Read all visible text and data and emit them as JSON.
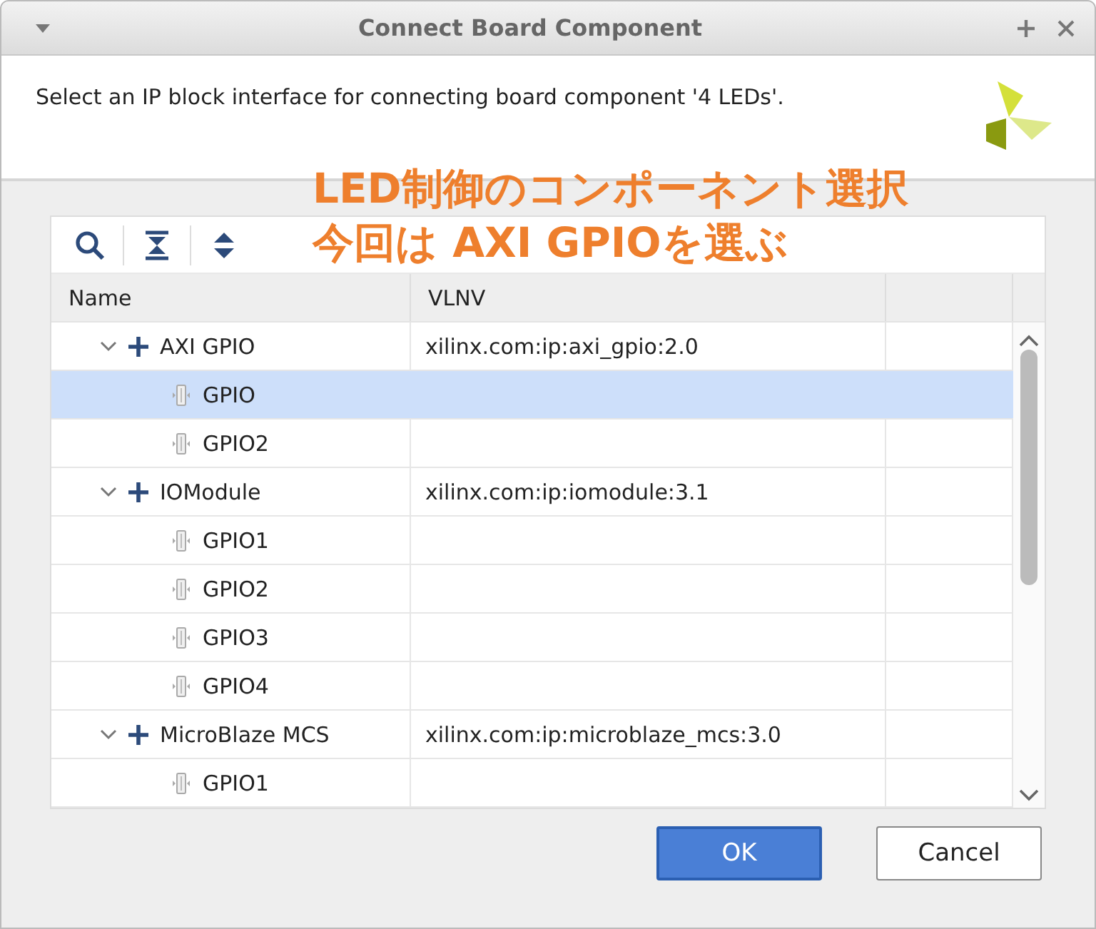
{
  "window": {
    "title": "Connect Board Component"
  },
  "message": "Select an IP block interface for connecting board component '4 LEDs'.",
  "annotation": [
    "LED制御のコンポーネント選択",
    "今回は AXI GPIOを選ぶ"
  ],
  "table": {
    "columns": [
      "Name",
      "VLNV"
    ],
    "rows": [
      {
        "name": "AXI GPIO",
        "vlnv": "xilinx.com:ip:axi_gpio:2.0",
        "expanded": true,
        "selected": false,
        "children": [
          {
            "name": "GPIO",
            "selected": true
          },
          {
            "name": "GPIO2",
            "selected": false
          }
        ]
      },
      {
        "name": "IOModule",
        "vlnv": "xilinx.com:ip:iomodule:3.1",
        "expanded": true,
        "selected": false,
        "children": [
          {
            "name": "GPIO1",
            "selected": false
          },
          {
            "name": "GPIO2",
            "selected": false
          },
          {
            "name": "GPIO3",
            "selected": false
          },
          {
            "name": "GPIO4",
            "selected": false
          }
        ]
      },
      {
        "name": "MicroBlaze MCS",
        "vlnv": "xilinx.com:ip:microblaze_mcs:3.0",
        "expanded": true,
        "selected": false,
        "children": [
          {
            "name": "GPIO1",
            "selected": false
          }
        ]
      }
    ]
  },
  "buttons": [
    {
      "label": "OK",
      "kind": "primary"
    },
    {
      "label": "Cancel",
      "kind": "normal"
    }
  ]
}
